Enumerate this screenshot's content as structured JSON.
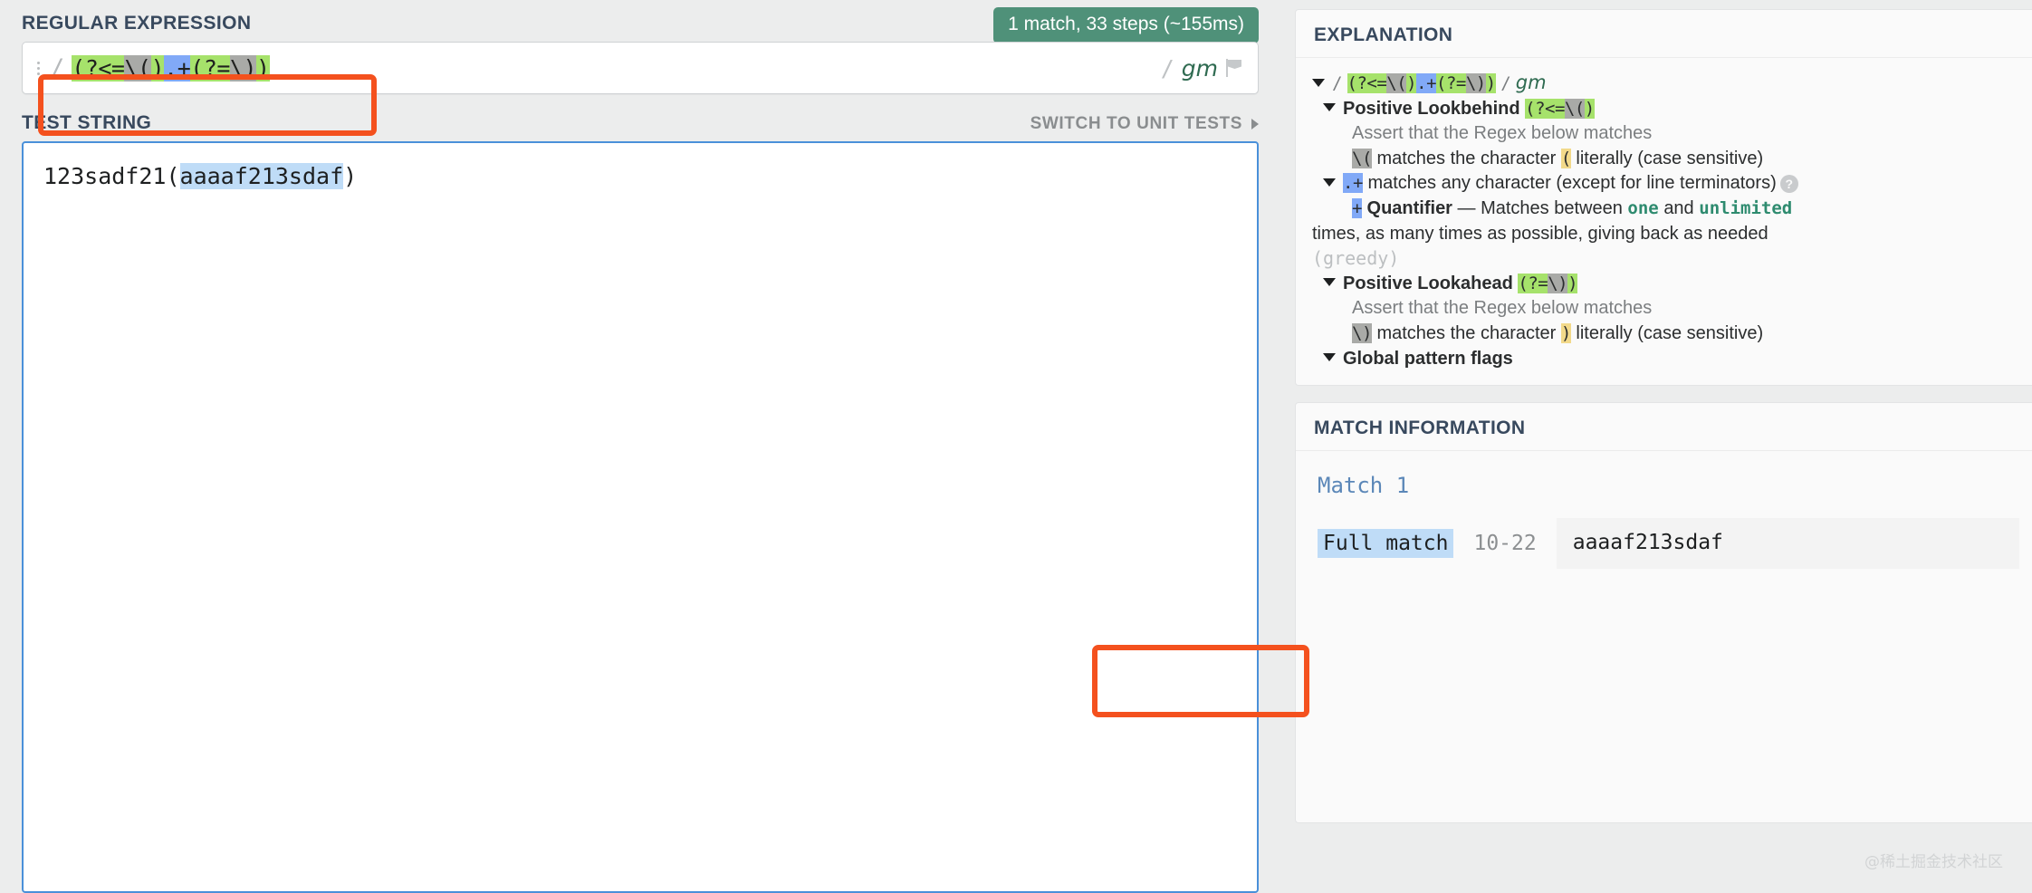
{
  "left": {
    "regex_section_title": "REGULAR EXPRESSION",
    "match_badge": "1 match, 33 steps (~155ms)",
    "regex_delim": "/",
    "regex_tokens": [
      {
        "text": "(?<=",
        "hl": "green"
      },
      {
        "text": "\\(",
        "hl": "gray"
      },
      {
        "text": ")",
        "hl": "green"
      },
      {
        "text": ".+",
        "hl": "blue"
      },
      {
        "text": "(?=",
        "hl": "green"
      },
      {
        "text": "\\)",
        "hl": "gray"
      },
      {
        "text": ")",
        "hl": "green"
      }
    ],
    "flags_slash": "/",
    "flags_value": "gm",
    "flag_icon_name": "flag-icon",
    "test_section_title": "TEST STRING",
    "switch_unit_tests": "SWITCH TO UNIT TESTS",
    "test_string_before": "123sadf21(",
    "test_string_match": "aaaaf213sdaf",
    "test_string_after": ")"
  },
  "explanation": {
    "title": "EXPLANATION",
    "root_slash": "/",
    "root_flags_slash": "/",
    "root_flags": "gm",
    "lookbehind_label": "Positive Lookbehind",
    "lookbehind_token": "(?<=\\()",
    "lookbehind_assert": "Assert that the Regex below matches",
    "lookbehind_escape": "\\(",
    "lookbehind_desc_1": "matches the character",
    "lookbehind_char": "(",
    "lookbehind_desc_2": "literally (case sensitive)",
    "dotplus_token": ".+",
    "dotplus_desc": "matches any character (except for line terminators)",
    "help_icon": "?",
    "quantifier_plus": "+",
    "quantifier_label": "Quantifier",
    "quantifier_dash": "—",
    "quantifier_text_1": "Matches between",
    "quantifier_min": "one",
    "quantifier_and": "and",
    "quantifier_max": "unlimited",
    "quantifier_text_2": "times, as many times as possible, giving back as needed",
    "quantifier_greedy": "(greedy)",
    "lookahead_label": "Positive Lookahead",
    "lookahead_token": "(?=\\))",
    "lookahead_assert": "Assert that the Regex below matches",
    "lookahead_escape": "\\)",
    "lookahead_desc_1": "matches the character",
    "lookahead_char": ")",
    "lookahead_desc_2": "literally (case sensitive)",
    "global_flags_label": "Global pattern flags"
  },
  "match_info": {
    "title": "MATCH INFORMATION",
    "match_label": "Match 1",
    "full_match_tag": "Full match",
    "range": "10-22",
    "value": "aaaaf213sdaf"
  },
  "watermark": "@稀土掘金技术社区",
  "colors": {
    "accent_orange": "#f4511e",
    "badge_green": "#4f9179",
    "title_navy": "#38495e",
    "hl_green": "#a6e26b",
    "hl_gray": "#a9aaa7",
    "hl_blue": "#81a9f7",
    "hl_yellow": "#f2d98a",
    "hl_lightblue": "#bfdcf7"
  }
}
